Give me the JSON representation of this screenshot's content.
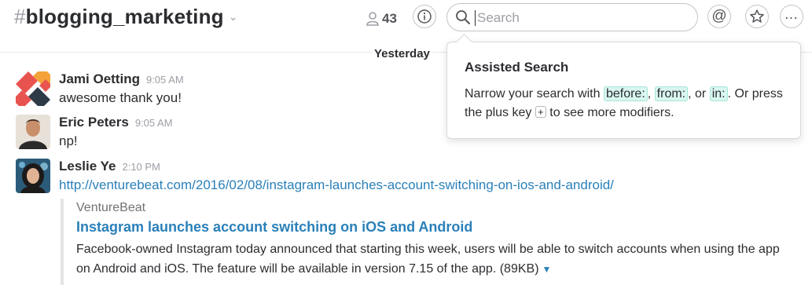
{
  "header": {
    "channel_hash": "#",
    "channel_name": "blogging_marketing",
    "member_count": "43",
    "search_placeholder": "Search"
  },
  "day_divider": "Yesterday",
  "messages": [
    {
      "author": "Jami Oetting",
      "time": "9:05 AM",
      "text": "awesome thank you!"
    },
    {
      "author": "Eric Peters",
      "time": "9:05 AM",
      "text": "np!"
    },
    {
      "author": "Leslie Ye",
      "time": "2:10 PM",
      "text": "http://venturebeat.com/2016/02/08/instagram-launches-account-switching-on-ios-and-android/"
    }
  ],
  "attachment": {
    "source": "VentureBeat",
    "title": "Instagram launches account switching on iOS and Android",
    "desc": "Facebook-owned Instagram today announced that starting this week, users will be able to switch accounts when using the app on Android and iOS. The feature will be available in version 7.15 of the app. (89KB)"
  },
  "popover": {
    "title": "Assisted Search",
    "line_prefix": "Narrow your search with ",
    "mod_before": "before:",
    "sep1": ",",
    "mod_from": "from:",
    "sep2": ", or",
    "mod_in": "in:",
    "line_mid": ". Or press the plus key",
    "plus_key": "+",
    "line_suffix": "to see more modifiers."
  },
  "colors": {
    "link": "#2a80b9",
    "modifier_bg": "#d9f6f0",
    "muted": "#9e9ea6"
  },
  "icons": [
    "person-icon",
    "info-icon",
    "search-icon",
    "at-sign-icon",
    "star-icon",
    "more-icon",
    "chevron-down-icon"
  ]
}
